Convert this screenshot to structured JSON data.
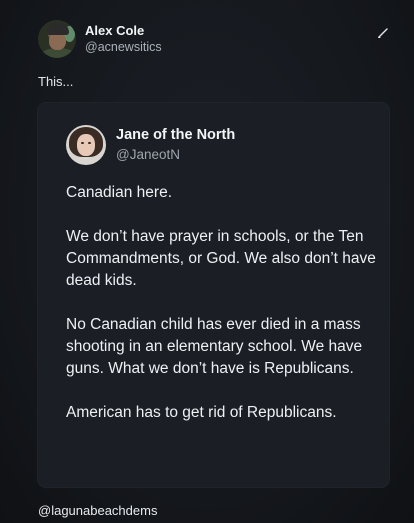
{
  "outer_post": {
    "display_name": "Alex Cole",
    "handle": "@acnewsitics",
    "text": "This..."
  },
  "quoted_post": {
    "display_name": "Jane of the North",
    "handle": "@JaneotN",
    "paragraphs": [
      "Canadian here.",
      "We don’t have prayer in schools, or the Ten Commandments, or God. We also don’t have dead kids.",
      "No Canadian child has ever died in a mass shooting in an elementary school. We have guns. What we don’t have is Republicans.",
      "American has to get rid of Republicans."
    ]
  },
  "watermark": "@lagunabeachdems",
  "icons": {
    "edit": "edit-icon"
  },
  "colors": {
    "background": "#13161b",
    "card": "#1b1f25",
    "text_primary": "#eef1f4",
    "text_secondary": "#9da5ae"
  }
}
